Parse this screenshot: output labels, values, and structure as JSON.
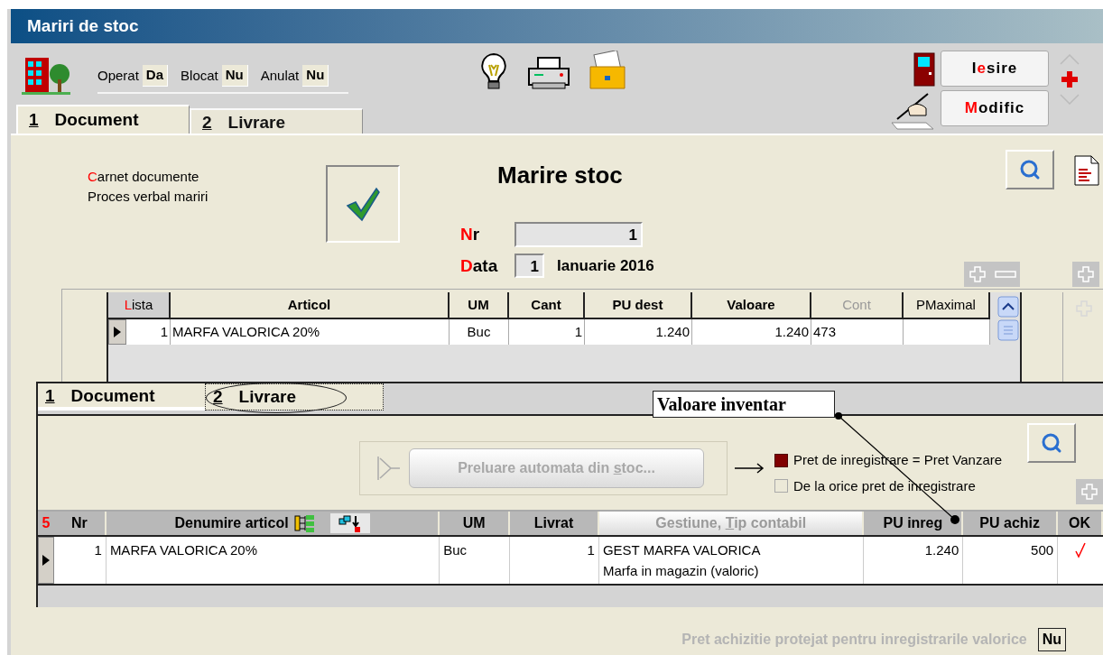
{
  "window": {
    "title": "Mariri de stoc"
  },
  "flags": [
    {
      "label": "Operat",
      "value": "Da"
    },
    {
      "label": "Blocat",
      "value": "Nu"
    },
    {
      "label": "Anulat",
      "value": "Nu"
    }
  ],
  "actions": [
    {
      "pre": "I",
      "key": "e",
      "text": "sire"
    },
    {
      "key": "M",
      "text": "odific"
    }
  ],
  "tabs": [
    {
      "key": "1",
      "text": "Document",
      "selected": true
    },
    {
      "key": "2",
      "text": "Livrare",
      "selected": false
    }
  ],
  "document": {
    "carnet": {
      "key": "C",
      "text": "arnet documente"
    },
    "carnet_value": "Proces verbal mariri",
    "confirmed": true,
    "heading": "Marire stoc",
    "nr": {
      "label": {
        "key": "N",
        "text": "r"
      },
      "value": "1"
    },
    "date": {
      "label": {
        "key": "D",
        "text": "ata"
      },
      "day": "1",
      "month_year": "Ianuarie 2016"
    }
  },
  "lines": {
    "columns": [
      {
        "key": "L",
        "text": "ista",
        "kind": "plain",
        "disabled": false
      },
      {
        "text": "Articol",
        "kind": "bold",
        "disabled": false
      },
      {
        "text": "UM",
        "kind": "bold",
        "disabled": false
      },
      {
        "text": "Cant",
        "kind": "bold",
        "disabled": false
      },
      {
        "text": "PU dest",
        "kind": "bold",
        "disabled": false
      },
      {
        "text": "Valoare",
        "kind": "bold",
        "disabled": false
      },
      {
        "text": "Cont",
        "kind": "plain",
        "disabled": true
      },
      {
        "text": "PMaximal",
        "kind": "plain",
        "disabled": false
      }
    ],
    "rows": [
      {
        "selected": true,
        "cells": [
          "1",
          "MARFA VALORICA  20%",
          "Buc",
          "1",
          "1.240",
          "1.240",
          "473"
        ]
      }
    ]
  },
  "delivery": {
    "tabs": [
      {
        "key": "1",
        "text": "Document",
        "selected": false
      },
      {
        "key": "2",
        "text": "Livrare",
        "selected": true
      }
    ],
    "callout": "Valoare inventar",
    "fetch_button": {
      "pre": "Preluare automata din ",
      "key": "s",
      "text": "toc...",
      "disabled": true
    },
    "price_options": [
      {
        "label": "Pret de inregistrare = Pret Vanzare",
        "checked": true
      },
      {
        "label": "De la orice pret de inregistrare",
        "checked": false
      }
    ],
    "count": "5",
    "columns": [
      {
        "text": "Nr",
        "kind": "text",
        "disabled": false
      },
      {
        "text": "Denumire articol",
        "kind": "icons",
        "disabled": false
      },
      {
        "text": "UM",
        "kind": "text",
        "disabled": false
      },
      {
        "text": "Livrat",
        "kind": "text",
        "disabled": false
      },
      {
        "pre": "Gestiune, ",
        "key": "T",
        "text": "ip contabil",
        "kind": "text",
        "disabled": true
      },
      {
        "text": "PU inreg",
        "kind": "text",
        "disabled": false
      },
      {
        "text": "PU achiz",
        "kind": "text",
        "disabled": false
      },
      {
        "text": "OK",
        "kind": "text",
        "disabled": false
      }
    ],
    "rows": [
      {
        "selected": true,
        "nr": "1",
        "name": "MARFA VALORICA 20%",
        "um": "Buc",
        "delivered": "1",
        "stock": "GEST MARFA VALORICA",
        "account_type": "Marfa in magazin (valoric)",
        "pu_inreg": "1.240",
        "pu_achiz": "500",
        "ok": true
      }
    ]
  },
  "protected_price": {
    "label": "Pret achizitie protejat pentru inregistrarile valorice",
    "value": "Nu",
    "disabled": true
  }
}
